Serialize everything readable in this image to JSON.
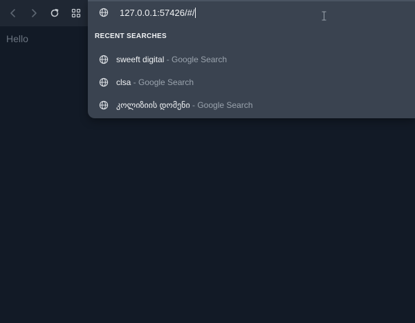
{
  "page": {
    "content_text": "Hello"
  },
  "omnibox": {
    "url": "127.0.0.1:57426/#/",
    "section_header": "RECENT SEARCHES",
    "suggestions": [
      {
        "query": "sweeft digital",
        "separator": " - ",
        "engine": "Google Search"
      },
      {
        "query": "clsa",
        "separator": " - ",
        "engine": "Google Search"
      },
      {
        "query": "კოლიზიის დომენი",
        "separator": " - ",
        "engine": "Google Search"
      }
    ]
  },
  "colors": {
    "page_background": "#121a26",
    "toolbar_background": "#1f2733",
    "dropdown_background": "#3a4350",
    "text_primary": "#f1f3f5",
    "text_secondary": "#9aa3ad"
  },
  "icons": {
    "back": "chevron-left-icon",
    "forward": "chevron-right-icon",
    "reload": "reload-icon",
    "apps": "grid-icon",
    "site": "globe-icon"
  }
}
